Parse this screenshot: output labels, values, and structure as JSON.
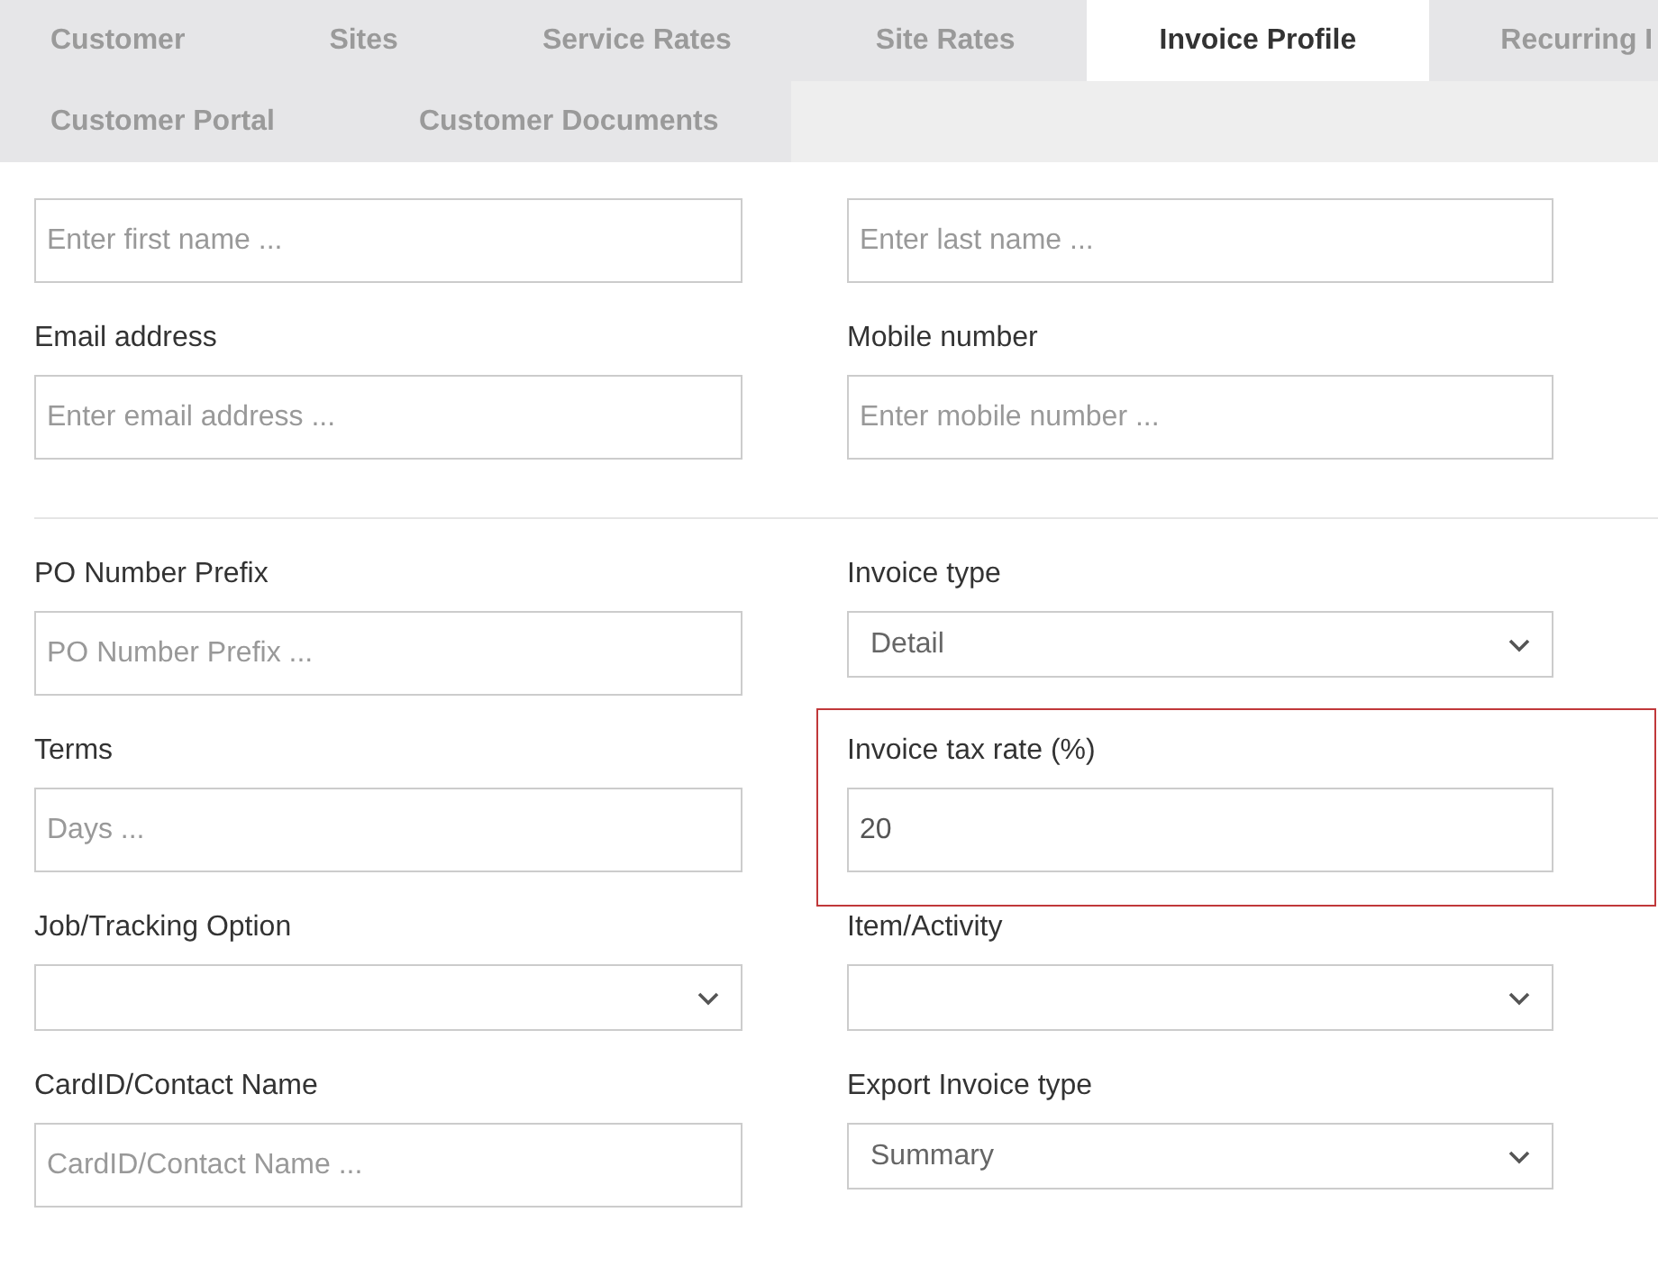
{
  "tab_rows": [
    [
      {
        "label": "Customer",
        "selected": false
      },
      {
        "label": "Sites",
        "selected": false
      },
      {
        "label": "Service Rates",
        "selected": false
      },
      {
        "label": "Site Rates",
        "selected": false
      },
      {
        "label": "Invoice Profile",
        "selected": true
      },
      {
        "label": "Recurring I",
        "selected": false
      }
    ],
    [
      {
        "label": "Customer Portal",
        "selected": false
      },
      {
        "label": "Customer Documents",
        "selected": false
      }
    ]
  ],
  "sections": [
    {
      "fields": [
        {
          "kind": "text",
          "placeholder": "Enter first name ...",
          "highlighted": false
        },
        {
          "kind": "text",
          "placeholder": "Enter last name ...",
          "highlighted": false
        },
        {
          "label": "Email address",
          "kind": "text",
          "placeholder": "Enter email address ...",
          "highlighted": false
        },
        {
          "label": "Mobile number",
          "kind": "text",
          "placeholder": "Enter mobile number ...",
          "highlighted": false
        }
      ]
    },
    {
      "fields": [
        {
          "label": "PO Number Prefix",
          "kind": "text",
          "placeholder": "PO Number Prefix ...",
          "highlighted": false
        },
        {
          "label": "Invoice type",
          "kind": "select",
          "value": "Detail",
          "highlighted": false
        },
        {
          "label": "Terms",
          "kind": "text",
          "placeholder": "Days ...",
          "highlighted": false
        },
        {
          "label": "Invoice tax rate (%)",
          "kind": "text",
          "value": "20",
          "highlighted": true
        },
        {
          "label": "Job/Tracking Option",
          "kind": "select",
          "highlighted": false
        },
        {
          "label": "Item/Activity",
          "kind": "select",
          "highlighted": false
        },
        {
          "label": "CardID/Contact Name",
          "kind": "text",
          "placeholder": "CardID/Contact Name ...",
          "highlighted": false
        },
        {
          "label": "Export Invoice type",
          "kind": "select",
          "value": "Summary",
          "highlighted": false
        }
      ]
    }
  ]
}
